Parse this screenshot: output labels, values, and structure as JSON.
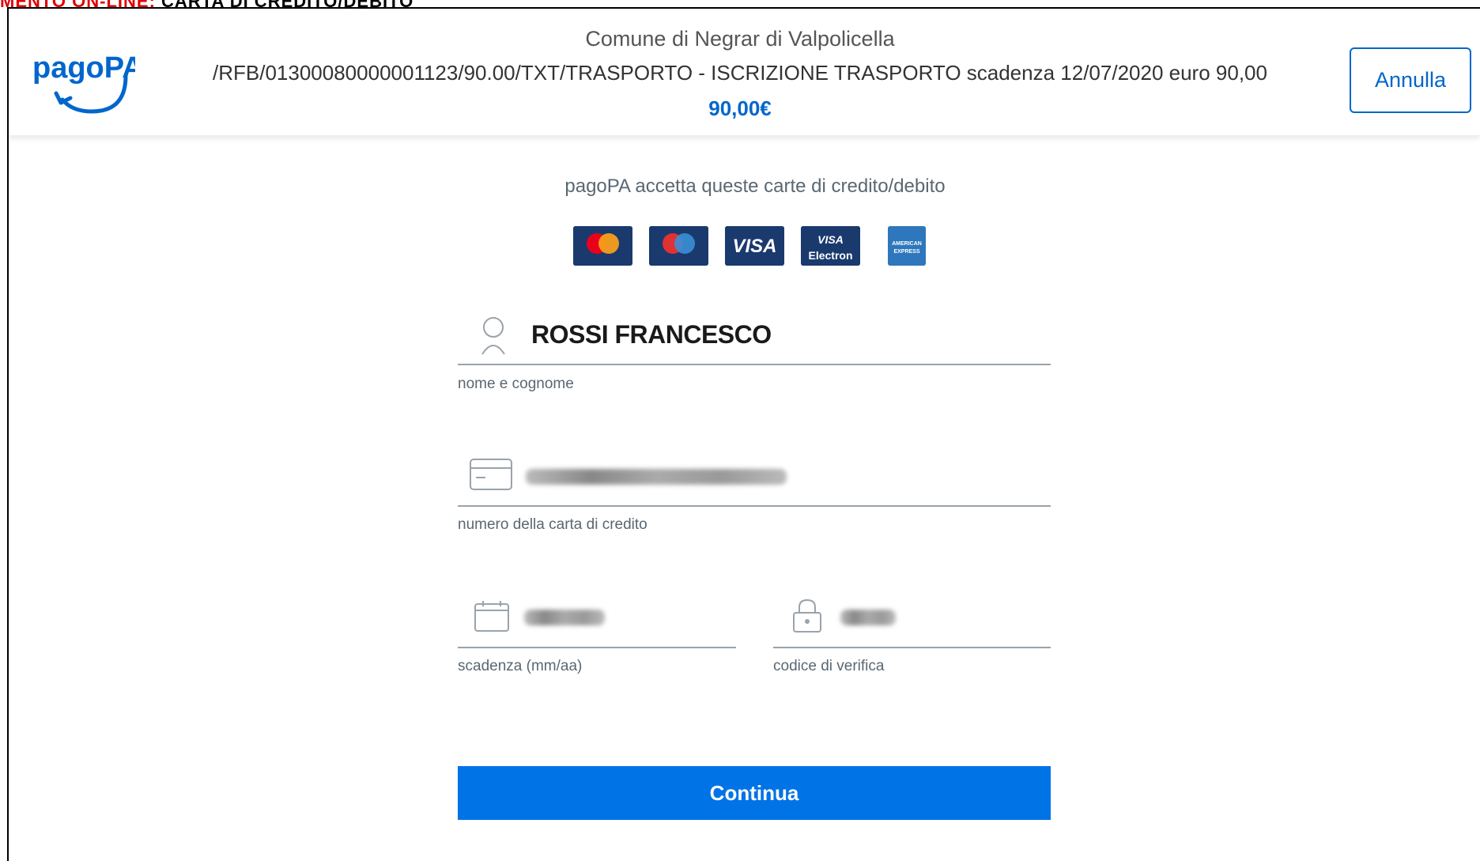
{
  "doc_caption": {
    "part1": "MENTO ON-LINE:",
    "part2": "CARTA DI CREDITO/DEBITO"
  },
  "header": {
    "logo_text": "pagoPA",
    "entity": "Comune di Negrar di Valpolicella",
    "description": "/RFB/01300080000001123/90.00/TXT/TRASPORTO - ISCRIZIONE TRASPORTO scadenza 12/07/2020 euro 90,00",
    "amount": "90,00€",
    "cancel_label": "Annulla"
  },
  "accepted": {
    "text": "pagoPA accetta queste carte di credito/debito",
    "cards": [
      {
        "name": "mastercard",
        "color": "#1a3a6e"
      },
      {
        "name": "maestro",
        "color": "#1a3a6e"
      },
      {
        "name": "visa",
        "label": "VISA",
        "color": "#1a3a6e"
      },
      {
        "name": "visa-electron",
        "label": "VISA Electron",
        "color": "#1a3a6e"
      },
      {
        "name": "american-express",
        "label": "AMERICAN EXPRESS",
        "color": "#2e77bc"
      }
    ]
  },
  "form": {
    "name": {
      "value": "ROSSI FRANCESCO",
      "label": "nome e cognome",
      "icon": "user-icon"
    },
    "card_number": {
      "label": "numero della carta di credito",
      "icon": "credit-card-icon"
    },
    "expiry": {
      "label": "scadenza (mm/aa)",
      "icon": "calendar-icon"
    },
    "cvv": {
      "label": "codice di verifica",
      "icon": "lock-icon"
    },
    "submit_label": "Continua"
  },
  "colors": {
    "accent": "#0073e6",
    "brand": "#0066cc"
  }
}
